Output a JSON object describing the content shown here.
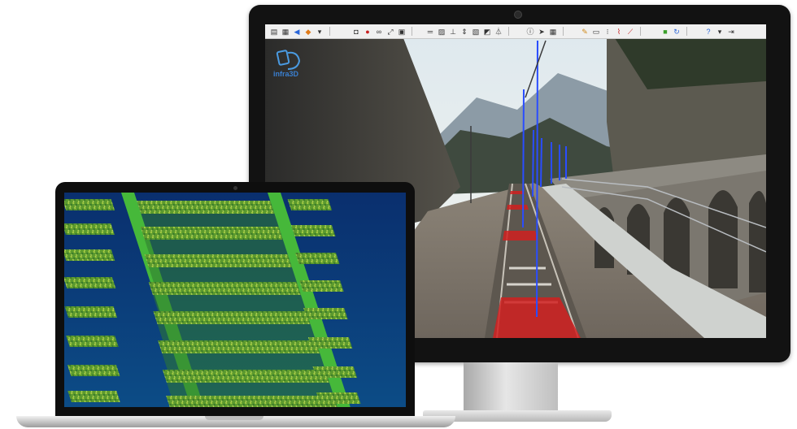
{
  "monitor": {
    "app_logo_text": "infra3D",
    "toolbar": {
      "groups": [
        [
          "layers-icon",
          "chart-icon",
          "back-arrow-icon",
          "diamond-icon",
          "dropdown-icon"
        ],
        [
          "camera-icon",
          "record-icon",
          "binoculars-icon",
          "expand-icon",
          "screen-icon"
        ],
        [
          "ruler-icon",
          "image-icon",
          "measure-icon",
          "height-icon",
          "photo-icon",
          "profile-icon",
          "level-icon"
        ],
        [
          "info-icon",
          "cursor-icon",
          "grid-icon"
        ],
        [
          "pencil-icon",
          "save-icon",
          "points-icon",
          "path-icon",
          "line-icon"
        ],
        [
          "export-icon",
          "refresh-icon"
        ],
        [
          "help-icon",
          "dropdown-icon",
          "logout-icon"
        ]
      ]
    },
    "scene": "railway viaduct street-level imagery with red track overlay and blue vertical markers"
  },
  "laptop": {
    "scene": "green point cloud of railway tracks on blue background"
  }
}
